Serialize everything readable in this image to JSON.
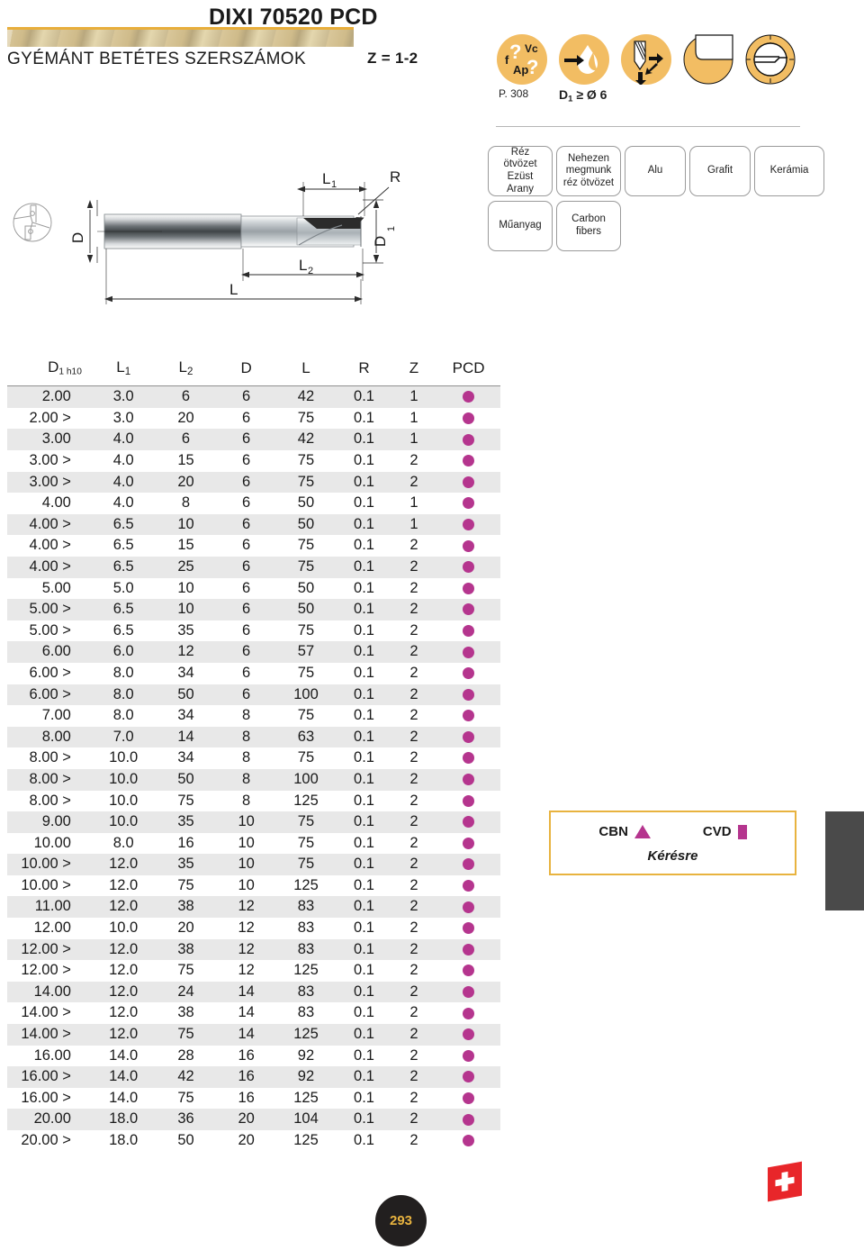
{
  "header": {
    "product_code": "DIXI 70520 PCD",
    "subtitle": "GYÉMÁNT BETÉTES SZERSZÁMOK",
    "flutes": "Z = 1-2",
    "icons": [
      {
        "name": "cutting-parameters-icon",
        "caption": "P. 308"
      },
      {
        "name": "coolant-lubrication-icon",
        "caption": "D1 ≥ Ø 6"
      },
      {
        "name": "drilling-direction-icon",
        "caption": ""
      },
      {
        "name": "corner-profile-icon",
        "caption": ""
      },
      {
        "name": "tool-section-icon",
        "caption": ""
      }
    ],
    "icon_caption_1": "P. 308",
    "icon_caption_2_d": "D",
    "icon_caption_2_sub": "1",
    "icon_caption_2_rest": "≥ Ø 6"
  },
  "materials": {
    "row1": [
      "Réz ötvözet\nEzüst\nArany",
      "Nehezen\nmegmunk\nréz ötvözet",
      "Alu",
      "Grafit",
      "Kerámia"
    ],
    "row2": [
      "Műanyag",
      "Carbon\nfibers"
    ]
  },
  "drawing": {
    "labels": {
      "d": "D",
      "d1": "D",
      "d1_sub": "1",
      "l": "L",
      "l1": "L",
      "l1_sub": "1",
      "l2": "L",
      "l2_sub": "2",
      "r": "R"
    }
  },
  "table": {
    "headers": [
      {
        "main": "D",
        "sub": "1 h10"
      },
      {
        "main": "L",
        "sub": "1"
      },
      {
        "main": "L",
        "sub": "2"
      },
      {
        "main": "D",
        "sub": ""
      },
      {
        "main": "L",
        "sub": ""
      },
      {
        "main": "R",
        "sub": ""
      },
      {
        "main": "Z",
        "sub": ""
      },
      {
        "main": "PCD",
        "sub": ""
      }
    ],
    "rows": [
      {
        "d1": "2.00",
        "l1": "3.0",
        "l2": "6",
        "d": "6",
        "l": "42",
        "r": "0.1",
        "z": "1",
        "pcd": true
      },
      {
        "d1": "2.00 >",
        "l1": "3.0",
        "l2": "20",
        "d": "6",
        "l": "75",
        "r": "0.1",
        "z": "1",
        "pcd": true
      },
      {
        "d1": "3.00",
        "l1": "4.0",
        "l2": "6",
        "d": "6",
        "l": "42",
        "r": "0.1",
        "z": "1",
        "pcd": true
      },
      {
        "d1": "3.00 >",
        "l1": "4.0",
        "l2": "15",
        "d": "6",
        "l": "75",
        "r": "0.1",
        "z": "2",
        "pcd": true
      },
      {
        "d1": "3.00 >",
        "l1": "4.0",
        "l2": "20",
        "d": "6",
        "l": "75",
        "r": "0.1",
        "z": "2",
        "pcd": true
      },
      {
        "d1": "4.00",
        "l1": "4.0",
        "l2": "8",
        "d": "6",
        "l": "50",
        "r": "0.1",
        "z": "1",
        "pcd": true
      },
      {
        "d1": "4.00 >",
        "l1": "6.5",
        "l2": "10",
        "d": "6",
        "l": "50",
        "r": "0.1",
        "z": "1",
        "pcd": true
      },
      {
        "d1": "4.00 >",
        "l1": "6.5",
        "l2": "15",
        "d": "6",
        "l": "75",
        "r": "0.1",
        "z": "2",
        "pcd": true
      },
      {
        "d1": "4.00 >",
        "l1": "6.5",
        "l2": "25",
        "d": "6",
        "l": "75",
        "r": "0.1",
        "z": "2",
        "pcd": true
      },
      {
        "d1": "5.00",
        "l1": "5.0",
        "l2": "10",
        "d": "6",
        "l": "50",
        "r": "0.1",
        "z": "2",
        "pcd": true
      },
      {
        "d1": "5.00 >",
        "l1": "6.5",
        "l2": "10",
        "d": "6",
        "l": "50",
        "r": "0.1",
        "z": "2",
        "pcd": true
      },
      {
        "d1": "5.00 >",
        "l1": "6.5",
        "l2": "35",
        "d": "6",
        "l": "75",
        "r": "0.1",
        "z": "2",
        "pcd": true
      },
      {
        "d1": "6.00",
        "l1": "6.0",
        "l2": "12",
        "d": "6",
        "l": "57",
        "r": "0.1",
        "z": "2",
        "pcd": true
      },
      {
        "d1": "6.00 >",
        "l1": "8.0",
        "l2": "34",
        "d": "6",
        "l": "75",
        "r": "0.1",
        "z": "2",
        "pcd": true
      },
      {
        "d1": "6.00 >",
        "l1": "8.0",
        "l2": "50",
        "d": "6",
        "l": "100",
        "r": "0.1",
        "z": "2",
        "pcd": true
      },
      {
        "d1": "7.00",
        "l1": "8.0",
        "l2": "34",
        "d": "8",
        "l": "75",
        "r": "0.1",
        "z": "2",
        "pcd": true
      },
      {
        "d1": "8.00",
        "l1": "7.0",
        "l2": "14",
        "d": "8",
        "l": "63",
        "r": "0.1",
        "z": "2",
        "pcd": true
      },
      {
        "d1": "8.00 >",
        "l1": "10.0",
        "l2": "34",
        "d": "8",
        "l": "75",
        "r": "0.1",
        "z": "2",
        "pcd": true
      },
      {
        "d1": "8.00 >",
        "l1": "10.0",
        "l2": "50",
        "d": "8",
        "l": "100",
        "r": "0.1",
        "z": "2",
        "pcd": true
      },
      {
        "d1": "8.00 >",
        "l1": "10.0",
        "l2": "75",
        "d": "8",
        "l": "125",
        "r": "0.1",
        "z": "2",
        "pcd": true
      },
      {
        "d1": "9.00",
        "l1": "10.0",
        "l2": "35",
        "d": "10",
        "l": "75",
        "r": "0.1",
        "z": "2",
        "pcd": true
      },
      {
        "d1": "10.00",
        "l1": "8.0",
        "l2": "16",
        "d": "10",
        "l": "75",
        "r": "0.1",
        "z": "2",
        "pcd": true
      },
      {
        "d1": "10.00 >",
        "l1": "12.0",
        "l2": "35",
        "d": "10",
        "l": "75",
        "r": "0.1",
        "z": "2",
        "pcd": true
      },
      {
        "d1": "10.00 >",
        "l1": "12.0",
        "l2": "75",
        "d": "10",
        "l": "125",
        "r": "0.1",
        "z": "2",
        "pcd": true
      },
      {
        "d1": "11.00",
        "l1": "12.0",
        "l2": "38",
        "d": "12",
        "l": "83",
        "r": "0.1",
        "z": "2",
        "pcd": true
      },
      {
        "d1": "12.00",
        "l1": "10.0",
        "l2": "20",
        "d": "12",
        "l": "83",
        "r": "0.1",
        "z": "2",
        "pcd": true
      },
      {
        "d1": "12.00 >",
        "l1": "12.0",
        "l2": "38",
        "d": "12",
        "l": "83",
        "r": "0.1",
        "z": "2",
        "pcd": true
      },
      {
        "d1": "12.00 >",
        "l1": "12.0",
        "l2": "75",
        "d": "12",
        "l": "125",
        "r": "0.1",
        "z": "2",
        "pcd": true
      },
      {
        "d1": "14.00",
        "l1": "12.0",
        "l2": "24",
        "d": "14",
        "l": "83",
        "r": "0.1",
        "z": "2",
        "pcd": true
      },
      {
        "d1": "14.00 >",
        "l1": "12.0",
        "l2": "38",
        "d": "14",
        "l": "83",
        "r": "0.1",
        "z": "2",
        "pcd": true
      },
      {
        "d1": "14.00 >",
        "l1": "12.0",
        "l2": "75",
        "d": "14",
        "l": "125",
        "r": "0.1",
        "z": "2",
        "pcd": true
      },
      {
        "d1": "16.00",
        "l1": "14.0",
        "l2": "28",
        "d": "16",
        "l": "92",
        "r": "0.1",
        "z": "2",
        "pcd": true
      },
      {
        "d1": "16.00 >",
        "l1": "14.0",
        "l2": "42",
        "d": "16",
        "l": "92",
        "r": "0.1",
        "z": "2",
        "pcd": true
      },
      {
        "d1": "16.00 >",
        "l1": "14.0",
        "l2": "75",
        "d": "16",
        "l": "125",
        "r": "0.1",
        "z": "2",
        "pcd": true
      },
      {
        "d1": "20.00",
        "l1": "18.0",
        "l2": "36",
        "d": "20",
        "l": "104",
        "r": "0.1",
        "z": "2",
        "pcd": true
      },
      {
        "d1": "20.00 >",
        "l1": "18.0",
        "l2": "50",
        "d": "20",
        "l": "125",
        "r": "0.1",
        "z": "2",
        "pcd": true
      }
    ]
  },
  "legend": {
    "cbn_label": "CBN",
    "cvd_label": "CVD",
    "note": "Kérésre"
  },
  "footer": {
    "page_number": "293",
    "flag": "swiss-flag"
  },
  "colors": {
    "accent_gold": "#e8b33f",
    "pcd_magenta": "#b5358e",
    "tab_dark": "#4a4a4a",
    "flag_red": "#e8262a"
  }
}
